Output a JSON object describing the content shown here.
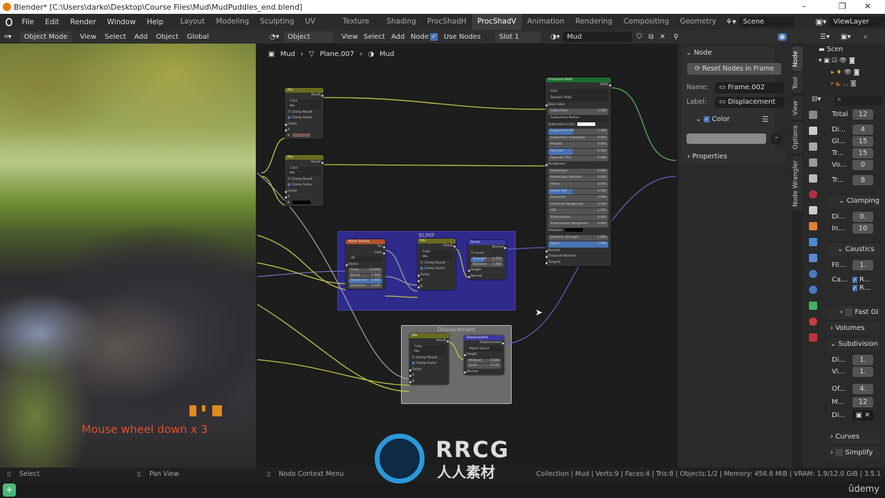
{
  "window": {
    "title": "Blender* [C:\\Users\\darko\\Desktop\\Course Files\\Mud\\MudPuddles_end.blend]",
    "minimize": "–",
    "maximize": "❐",
    "close": "✕"
  },
  "menu": {
    "items": [
      "File",
      "Edit",
      "Render",
      "Window",
      "Help"
    ],
    "workspaces": [
      "Layout",
      "Modeling",
      "Sculpting",
      "UV Editing",
      "Texture Paint",
      "Shading",
      "ProcShadH",
      "ProcShadV",
      "Animation",
      "Rendering",
      "Compositing",
      "Geometry Nod"
    ],
    "active_workspace": "ProcShadV",
    "scene": "Scene",
    "view_layer": "ViewLayer"
  },
  "viewport_header": {
    "mode": "Object Mode",
    "items": [
      "View",
      "Select",
      "Add",
      "Object"
    ],
    "transform": "Global"
  },
  "node_header": {
    "type": "Object",
    "items": [
      "View",
      "Select",
      "Add",
      "Node"
    ],
    "use_nodes_label": "Use Nodes",
    "use_nodes": true,
    "slot": "Slot 1",
    "material": "Mud"
  },
  "breadcrumb": [
    "Mud",
    "Plane.007",
    "Mud"
  ],
  "viewport_overlay": {
    "text": "Mouse wheel down x 3"
  },
  "frames": {
    "bump": {
      "label": "BUMP",
      "color": "#2e2b8c"
    },
    "displacement": {
      "label": "Displacement",
      "color": "#6b6b6b"
    }
  },
  "nodes": [
    {
      "id": "mix1",
      "title": "Mix",
      "color": "#6b6b1e",
      "rows": [
        {
          "t": "out",
          "l": "Result"
        },
        {
          "t": "dd",
          "l": "Color"
        },
        {
          "t": "dd",
          "l": "Mix"
        },
        {
          "t": "chk",
          "l": "Clamp Result",
          "on": false
        },
        {
          "t": "chk",
          "l": "Clamp Factor",
          "on": true
        },
        {
          "t": "in",
          "l": "Factor"
        },
        {
          "t": "in",
          "l": "A"
        },
        {
          "t": "col",
          "l": "B",
          "c": "#7a5a50"
        }
      ]
    },
    {
      "id": "mix2",
      "title": "Mix",
      "color": "#6b6b1e",
      "rows": [
        {
          "t": "out",
          "l": "Result"
        },
        {
          "t": "dd",
          "l": "Color"
        },
        {
          "t": "dd",
          "l": "Mix"
        },
        {
          "t": "chk",
          "l": "Clamp Result",
          "on": false
        },
        {
          "t": "chk",
          "l": "Clamp Factor",
          "on": true
        },
        {
          "t": "in",
          "l": "Factor"
        },
        {
          "t": "in",
          "l": "A"
        },
        {
          "t": "col",
          "l": "B",
          "c": "#000000"
        }
      ]
    },
    {
      "id": "bsdf",
      "title": "Principled BSDF",
      "color": "#1f6b30",
      "rows": [
        {
          "t": "out",
          "l": "BSDF"
        },
        {
          "t": "dd",
          "l": "GGX"
        },
        {
          "t": "dd",
          "l": "Random Walk"
        },
        {
          "t": "in",
          "l": "Base Color"
        },
        {
          "t": "f",
          "l": "Subsurface",
          "v": "0.000"
        },
        {
          "t": "dd",
          "l": "Subsurface Radius"
        },
        {
          "t": "col",
          "l": "Subsurface Color",
          "c": "#ffffff"
        },
        {
          "t": "f",
          "l": "Subsurface IOR",
          "v": "1.400",
          "hl": true
        },
        {
          "t": "f",
          "l": "Subsurface Anisotropy",
          "v": "0.000"
        },
        {
          "t": "f",
          "l": "Metallic",
          "v": "0.000"
        },
        {
          "t": "f",
          "l": "Specular",
          "v": "0.500",
          "hl": true
        },
        {
          "t": "f",
          "l": "Specular Tint",
          "v": "0.000"
        },
        {
          "t": "in",
          "l": "Roughness"
        },
        {
          "t": "f",
          "l": "Anisotropic",
          "v": "0.000"
        },
        {
          "t": "f",
          "l": "Anisotropic Rotation",
          "v": "0.000"
        },
        {
          "t": "f",
          "l": "Sheen",
          "v": "0.000"
        },
        {
          "t": "f",
          "l": "Sheen Tint",
          "v": "0.500",
          "hl": true
        },
        {
          "t": "f",
          "l": "Clearcoat",
          "v": "0.000"
        },
        {
          "t": "f",
          "l": "Clearcoat Roughness",
          "v": "0.030"
        },
        {
          "t": "f",
          "l": "IOR",
          "v": "1.450"
        },
        {
          "t": "f",
          "l": "Transmission",
          "v": "0.000"
        },
        {
          "t": "f",
          "l": "Transmission Roughness",
          "v": "0.000"
        },
        {
          "t": "col",
          "l": "Emission",
          "c": "#000000"
        },
        {
          "t": "f",
          "l": "Emission Strength",
          "v": "1.000"
        },
        {
          "t": "f",
          "l": "Alpha",
          "v": "1.000",
          "full": true
        },
        {
          "t": "in",
          "l": "Normal"
        },
        {
          "t": "in",
          "l": "Clearcoat Normal"
        },
        {
          "t": "in",
          "l": "Tangent"
        }
      ]
    },
    {
      "id": "noise",
      "title": "Noise Texture",
      "color": "#b0522a",
      "rows": [
        {
          "t": "out",
          "l": "Fac"
        },
        {
          "t": "out",
          "l": "Color"
        },
        {
          "t": "dd",
          "l": "3D"
        },
        {
          "t": "in",
          "l": "Vector"
        },
        {
          "t": "f",
          "l": "Scale",
          "v": "10.000"
        },
        {
          "t": "f",
          "l": "Detail",
          "v": "7.920"
        },
        {
          "t": "f",
          "l": "Roughness",
          "v": "0.800",
          "full": true
        },
        {
          "t": "f",
          "l": "Distortion",
          "v": "0.100"
        }
      ]
    },
    {
      "id": "mix3",
      "title": "Mix",
      "color": "#6b6b1e",
      "rows": [
        {
          "t": "out",
          "l": "Result"
        },
        {
          "t": "dd",
          "l": "Color"
        },
        {
          "t": "dd",
          "l": "Mix"
        },
        {
          "t": "chk",
          "l": "Clamp Result",
          "on": false
        },
        {
          "t": "chk",
          "l": "Clamp Factor",
          "on": true
        },
        {
          "t": "in",
          "l": "Factor"
        },
        {
          "t": "in",
          "l": "A"
        },
        {
          "t": "in",
          "l": "B"
        }
      ]
    },
    {
      "id": "bump",
      "title": "Bump",
      "color": "#3a3aa0",
      "rows": [
        {
          "t": "out",
          "l": "Normal"
        },
        {
          "t": "chk",
          "l": "Invert",
          "on": false
        },
        {
          "t": "f",
          "l": "Strength",
          "v": "0.250",
          "hl": true
        },
        {
          "t": "f",
          "l": "Distance",
          "v": "1.000"
        },
        {
          "t": "in",
          "l": "Height"
        },
        {
          "t": "in",
          "l": "Normal"
        }
      ]
    },
    {
      "id": "mix4",
      "title": "Mix",
      "color": "#6b6b1e",
      "rows": [
        {
          "t": "out",
          "l": "Result"
        },
        {
          "t": "dd",
          "l": "Color"
        },
        {
          "t": "dd",
          "l": "Mix"
        },
        {
          "t": "chk",
          "l": "Clamp Result",
          "on": false
        },
        {
          "t": "chk",
          "l": "Clamp Factor",
          "on": true
        },
        {
          "t": "in",
          "l": "Factor"
        },
        {
          "t": "in",
          "l": "A"
        },
        {
          "t": "in",
          "l": "B"
        }
      ]
    },
    {
      "id": "disp",
      "title": "Displacement",
      "color": "#3a3aa0",
      "rows": [
        {
          "t": "out",
          "l": "Displacement"
        },
        {
          "t": "dd",
          "l": "Object Space"
        },
        {
          "t": "in",
          "l": "Height"
        },
        {
          "t": "f",
          "l": "Midlevel",
          "v": "0.500"
        },
        {
          "t": "f",
          "l": "Scale",
          "v": "0.150"
        },
        {
          "t": "in",
          "l": "Normal"
        }
      ]
    }
  ],
  "npanel": {
    "section": "Node",
    "reset_button": "Reset Nodes in Frame",
    "name_label": "Name:",
    "name": "Frame.002",
    "label_label": "Label:",
    "label": "Displacement",
    "color_label": "Color",
    "color_enabled": true,
    "frame_color": "#8a8a8a",
    "properties_label": "Properties"
  },
  "side_tabs": [
    "Node",
    "Tool",
    "View",
    "Options",
    "Node Wrangler"
  ],
  "active_side_tab": "Node",
  "outliner": {
    "root": "Scen"
  },
  "properties": {
    "rows1": [
      {
        "l": "Total",
        "v": "12"
      },
      {
        "l": "Di...",
        "v": "4"
      },
      {
        "l": "Gl...",
        "v": "15"
      },
      {
        "l": "Tr...",
        "v": "15"
      },
      {
        "l": "Vo...",
        "v": "0"
      },
      {
        "l": "Tr...",
        "v": "8"
      }
    ],
    "clamping": {
      "title": "Clamping",
      "rows": [
        {
          "l": "Di...",
          "v": "0."
        },
        {
          "l": "In...",
          "v": "10"
        }
      ]
    },
    "caustics": {
      "title": "Caustics",
      "rows": [
        {
          "l": "Fil...",
          "v": "1."
        }
      ],
      "ca_label": "Ca...",
      "checks": [
        "R...",
        "R..."
      ]
    },
    "fast_gi": "Fast GI",
    "volumes": "Volumes",
    "subdivision": {
      "title": "Subdivision",
      "rows": [
        {
          "l": "Di...",
          "v": "1."
        },
        {
          "l": "Vi...",
          "v": "1."
        },
        {
          "l": "Of...",
          "v": "4."
        },
        {
          "l": "M...",
          "v": "12"
        }
      ],
      "di_label": "Di..."
    },
    "curves": "Curves",
    "simplify": "Simplify"
  },
  "status": {
    "select": "Select",
    "pan": "Pan View",
    "context": "Node Context Menu",
    "info": "Collection | Mud | Verts:9 | Faces:4 | Tris:8 | Objects:1/2 | Memory: 456.8 MiB | VRAM: 1.9/12.0 GiB | 3.5.1"
  },
  "watermark": {
    "brand": "RRCG",
    "sub": "人人素材",
    "udemy": "ûdemy"
  }
}
